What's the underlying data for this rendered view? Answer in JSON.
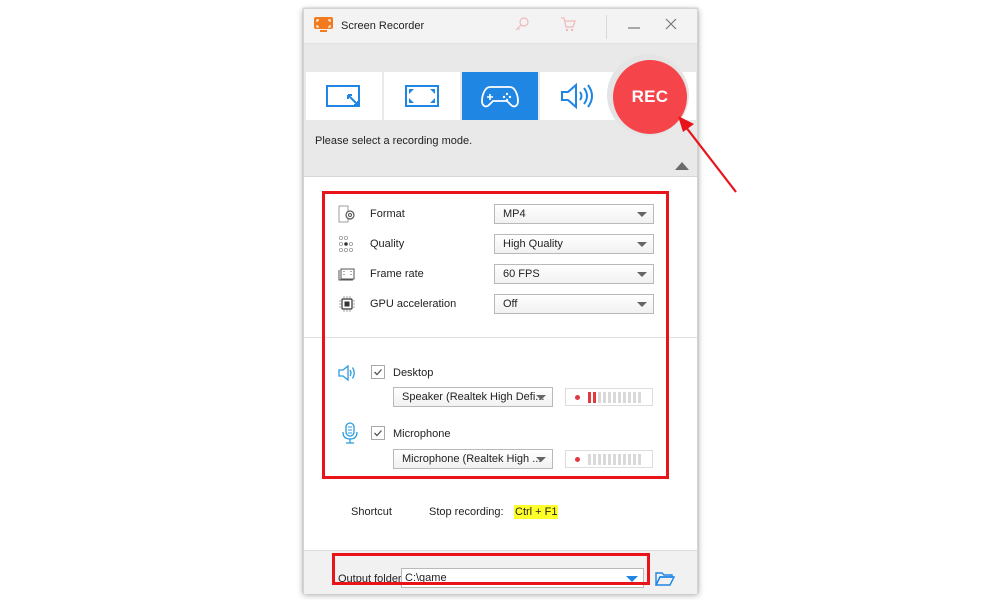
{
  "window": {
    "title": "Screen Recorder",
    "icons": {
      "app": "screen-recorder-logo-icon",
      "register": "key-icon",
      "buy": "cart-icon",
      "minimize": "minimize-icon",
      "close": "close-icon"
    }
  },
  "modes": {
    "tiles": [
      {
        "id": "region",
        "icon": "region-select-icon",
        "active": false
      },
      {
        "id": "fullscreen",
        "icon": "fullscreen-icon",
        "active": false
      },
      {
        "id": "game",
        "icon": "gamepad-icon",
        "active": true
      },
      {
        "id": "audio",
        "icon": "speaker-icon",
        "active": false
      }
    ],
    "rec_label": "REC",
    "hint": "Please select a recording mode.",
    "collapse_icon": "triangle-up-icon"
  },
  "settings": {
    "rows": [
      {
        "label": "Format",
        "value": "MP4",
        "icon": "format-gear-icon"
      },
      {
        "label": "Quality",
        "value": "High Quality",
        "icon": "quality-dots-icon"
      },
      {
        "label": "Frame rate",
        "value": "60 FPS",
        "icon": "frame-rate-icon"
      },
      {
        "label": "GPU acceleration",
        "value": "Off",
        "icon": "gpu-chip-icon"
      }
    ]
  },
  "audio": {
    "desktop": {
      "label": "Desktop",
      "checked": true,
      "device": "Speaker (Realtek High Defi...",
      "level_bars_on": 2,
      "level_bars_total": 11
    },
    "microphone": {
      "label": "Microphone",
      "checked": true,
      "device": "Microphone (Realtek High ...",
      "level_bars_on": 0,
      "level_bars_total": 11
    }
  },
  "shortcut": {
    "label": "Shortcut",
    "action": "Stop recording:",
    "keys": "Ctrl + F1"
  },
  "output": {
    "label": "Output folder:",
    "value": "C:\\game",
    "folder_icon": "folder-open-icon"
  },
  "colors": {
    "accent": "#1f86e3",
    "rec": "#f5454a",
    "highlight_box": "#e8141a",
    "hotkey_highlight": "#ffff2a"
  }
}
